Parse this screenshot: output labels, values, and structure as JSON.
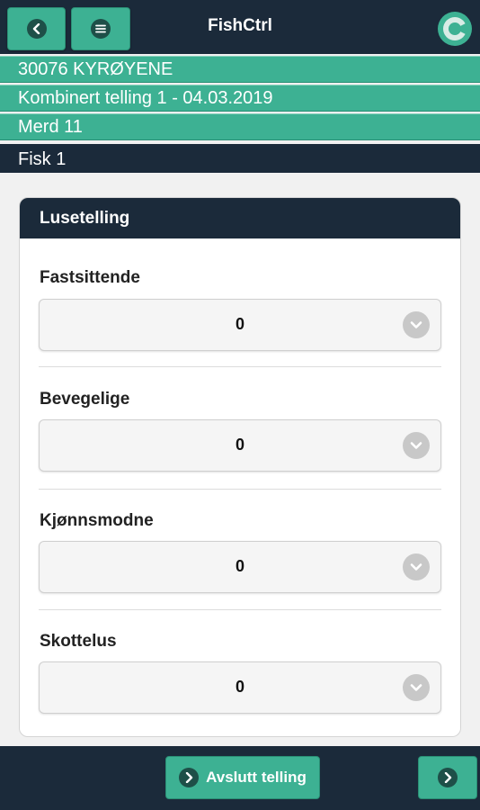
{
  "header": {
    "title": "FishCtrl",
    "back_icon": "chevron-left-icon",
    "menu_icon": "hamburger-icon",
    "logo_icon": "fishctrl-logo-icon"
  },
  "breadcrumbs": [
    "30076 KYRØYENE",
    "Kombinert telling 1 - 04.03.2019",
    "Merd 11",
    "Fisk 1"
  ],
  "card": {
    "title": "Lusetelling",
    "fields": [
      {
        "label": "Fastsittende",
        "value": "0"
      },
      {
        "label": "Bevegelige",
        "value": "0"
      },
      {
        "label": "Kjønnsmodne",
        "value": "0"
      },
      {
        "label": "Skottelus",
        "value": "0"
      }
    ]
  },
  "footer": {
    "finish_label": "Avslutt telling",
    "next_icon": "chevron-right-icon"
  },
  "colors": {
    "accent": "#3db193",
    "dark": "#1b2a3a"
  }
}
